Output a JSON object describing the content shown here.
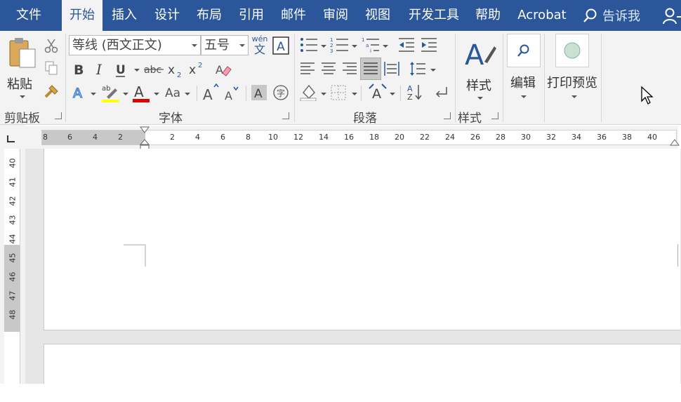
{
  "tabs": [
    "文件",
    "开始",
    "插入",
    "设计",
    "布局",
    "引用",
    "邮件",
    "审阅",
    "视图",
    "开发工具",
    "帮助",
    "Acrobat"
  ],
  "tell_me": "告诉我",
  "clipboard": {
    "paste": "粘贴",
    "label": "剪贴板"
  },
  "font": {
    "name": "等线 (西文正文)",
    "size": "五号",
    "label": "字体",
    "wen": "wén",
    "wen_char": "文"
  },
  "paragraph": {
    "label": "段落"
  },
  "styles": {
    "button": "样式",
    "label": "样式"
  },
  "editing": {
    "button": "编辑"
  },
  "print_preview": {
    "button": "打印预览"
  },
  "ruler": {
    "left_ticks": [
      "8",
      "6",
      "4",
      "2"
    ],
    "ticks": [
      "2",
      "4",
      "6",
      "8",
      "10",
      "12",
      "14",
      "16",
      "18",
      "20",
      "22",
      "24",
      "26",
      "28",
      "30",
      "32",
      "34",
      "36",
      "38",
      "40"
    ]
  },
  "vruler": {
    "ticks": [
      "40",
      "41",
      "42",
      "43",
      "44",
      "45",
      "46",
      "47",
      "48"
    ]
  },
  "colors": {
    "accent": "#2b579a",
    "highlight": "#ffff00",
    "font_color": "#e00000"
  }
}
